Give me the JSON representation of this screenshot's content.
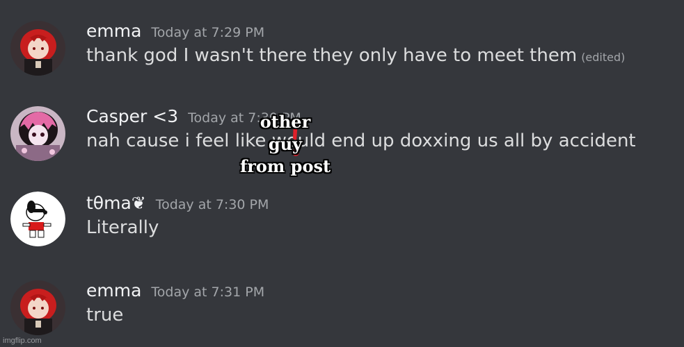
{
  "messages": [
    {
      "username": "emma",
      "timestamp": "Today at 7:29 PM",
      "text": "thank god I wasn't there they only have to meet them",
      "edited_label": "(edited)",
      "avatar": "red-hair-anime-avatar-icon"
    },
    {
      "username": "Casper <3",
      "timestamp": "Today at 7:30 PM",
      "text": "nah cause i feel like       would end up doxxing us all by accident",
      "avatar": "pink-doll-avatar-icon"
    },
    {
      "username": "tθma❦",
      "timestamp": "Today at 7:30 PM",
      "text": "Literally",
      "avatar": "snoopy-avatar-icon"
    },
    {
      "username": "emma",
      "timestamp": "Today at 7:31 PM",
      "text": "true",
      "avatar": "red-hair-anime-avatar-icon"
    }
  ],
  "overlay": {
    "line1": "other",
    "line2": "guy",
    "line3": "from post"
  },
  "watermark": "imgflip.com",
  "colors": {
    "background": "#35373c",
    "username": "#f2f3f5",
    "timestamp": "#a3a6aa",
    "message_text": "#dcddde",
    "censor_red": "#e0202a"
  }
}
